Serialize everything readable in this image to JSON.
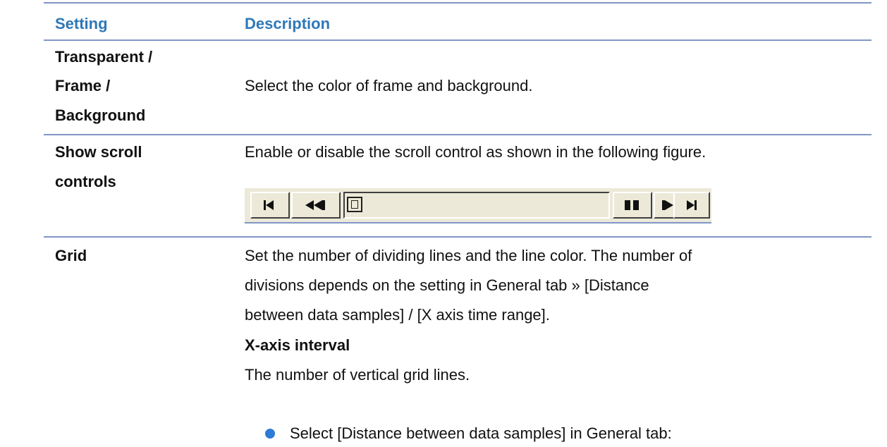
{
  "header": {
    "setting": "Setting",
    "description": "Description"
  },
  "rows": {
    "transparent": {
      "label_lines": [
        "Transparent /",
        "Frame /",
        "Background"
      ],
      "description": "Select the color of frame and background."
    },
    "scroll": {
      "label_lines": [
        "Show scroll",
        "controls"
      ],
      "description": "Enable or disable the scroll control as shown in the following figure.",
      "figure_buttons": [
        "skip-to-start-icon",
        "rewind-icon",
        "scroll-thumb-icon",
        "pause-icon",
        "fast-forward-icon",
        "skip-to-end-icon"
      ]
    },
    "grid": {
      "label": "Grid",
      "lines": [
        "Set the number of dividing lines and the line color. The number of",
        "divisions depends on the setting in General tab » [Distance",
        "between data samples] / [X axis time range]."
      ],
      "subheading": "X-axis interval",
      "sub_text": "The number of vertical grid lines.",
      "bullet": "Select [Distance between data samples] in General tab:"
    }
  },
  "colors": {
    "heading": "#2f78b8",
    "rule": "#8096c6",
    "bullet": "#2e7ad6",
    "scroll_face": "#ece9d8"
  }
}
